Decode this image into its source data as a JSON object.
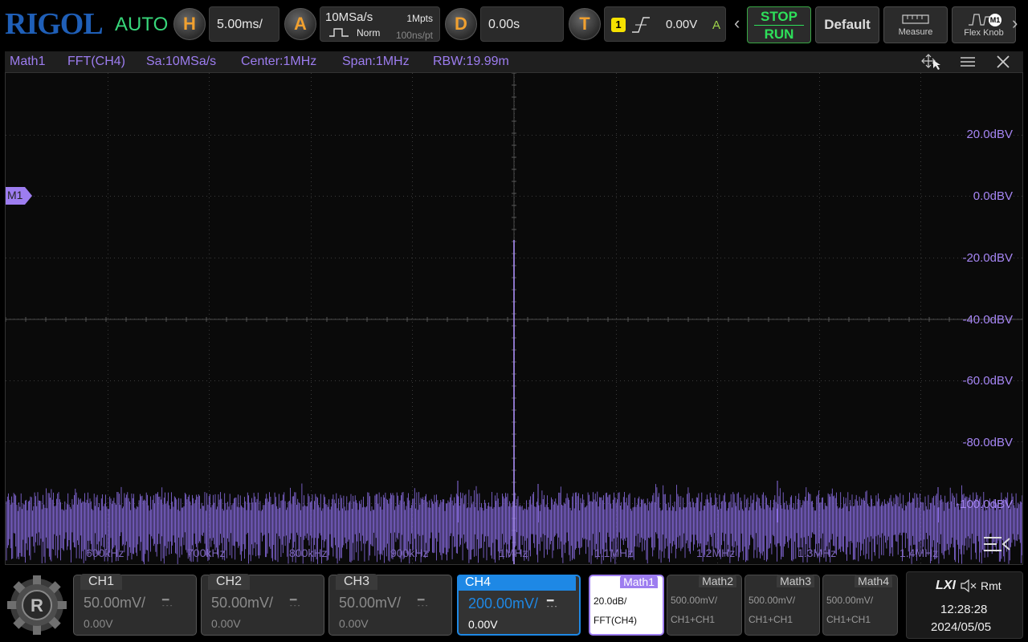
{
  "header": {
    "brand": "RIGOL",
    "trigger_mode": "AUTO",
    "horizontal": {
      "knob": "H",
      "timebase": "5.00ms/"
    },
    "acquire": {
      "knob": "A",
      "sample_rate": "10MSa/s",
      "depth": "1Mpts",
      "acq_mode": "Norm",
      "resolution": "100ns/pt"
    },
    "delay": {
      "knob": "D",
      "value": "0.00s"
    },
    "trigger": {
      "knob": "T",
      "source": "1",
      "level": "0.00V",
      "status": "A",
      "edge_icon": "rising-edge-icon"
    },
    "run_control": {
      "stop": "STOP",
      "run": "RUN"
    },
    "default_label": "Default",
    "measure_label": "Measure",
    "flex_label": "Flex Knob",
    "flex_badge": "M1"
  },
  "math_header": {
    "name": "Math1",
    "func": "FFT(CH4)",
    "sa": "Sa:10MSa/s",
    "center": "Center:1MHz",
    "span": "Span:1MHz",
    "rbw": "RBW:19.99m"
  },
  "plot": {
    "marker": "M1",
    "y_labels": [
      "20.0dBV",
      "0.0dBV",
      "-20.0dBV",
      "-40.0dBV",
      "-60.0dBV",
      "-80.0dBV",
      "-100.0dBV"
    ],
    "x_labels": [
      "600kHz",
      "700kHz",
      "800kHz",
      "900kHz",
      "1MHz",
      "1.1MHz",
      "1.2MHz",
      "1.3MHz",
      "1.4MHz"
    ]
  },
  "channels": [
    {
      "name": "CH1",
      "scale": "50.00mV/",
      "offset": "0.00V",
      "active": false
    },
    {
      "name": "CH2",
      "scale": "50.00mV/",
      "offset": "0.00V",
      "active": false
    },
    {
      "name": "CH3",
      "scale": "50.00mV/",
      "offset": "0.00V",
      "active": false
    },
    {
      "name": "CH4",
      "scale": "200.00mV/",
      "offset": "0.00V",
      "active": true
    }
  ],
  "maths": [
    {
      "name": "Math1",
      "l1": "20.0dB/",
      "l2": "FFT(CH4)",
      "active": true
    },
    {
      "name": "Math2",
      "l1": "500.00mV/",
      "l2": "CH1+CH1",
      "active": false
    },
    {
      "name": "Math3",
      "l1": "500.00mV/",
      "l2": "CH1+CH1",
      "active": false
    },
    {
      "name": "Math4",
      "l1": "500.00mV/",
      "l2": "CH1+CH1",
      "active": false
    }
  ],
  "status": {
    "lxi": "LXI",
    "remote": "Rmt",
    "time": "12:28:28",
    "date": "2024/05/05"
  },
  "colors": {
    "math": "#9d7df0",
    "trace": "#8c6ee6",
    "active_ch": "#1e88e5",
    "run_green": "#2ee05a",
    "knob_orange": "#f0a030",
    "brand_blue": "#1f5fb8"
  }
}
